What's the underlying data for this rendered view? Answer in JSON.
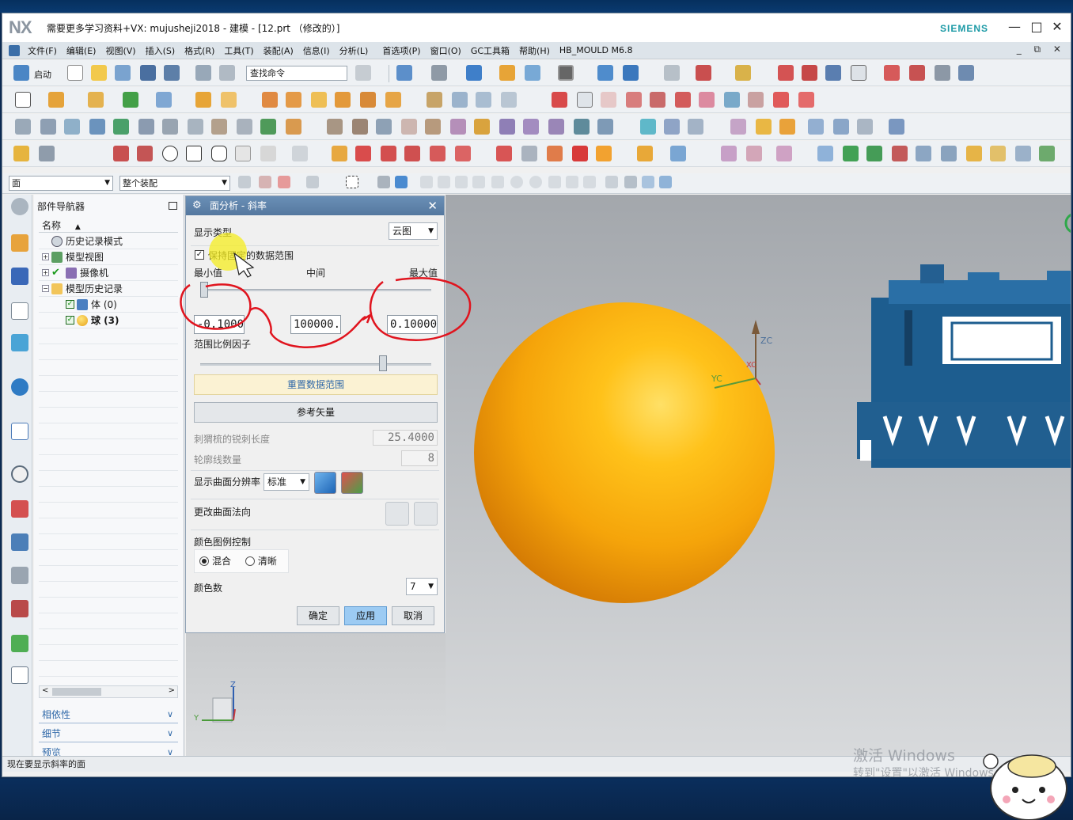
{
  "window": {
    "logo": "NX",
    "title": "需要更多学习资料+VX: mujusheji2018 - 建模 - [12.prt （修改的）]",
    "brand": "SIEMENS",
    "minimize": "—",
    "maximize": "□",
    "close": "✕"
  },
  "menu": {
    "items": [
      "文件(F)",
      "编辑(E)",
      "视图(V)",
      "插入(S)",
      "格式(R)",
      "工具(T)",
      "装配(A)",
      "信息(I)",
      "分析(L)",
      "首选项(P)",
      "窗口(O)",
      "GC工具箱",
      "帮助(H)",
      "HB_MOULD M6.8"
    ],
    "right_controls": "_ ⧉ ✕"
  },
  "toolbar": {
    "start_label": "启动",
    "search_placeholder": "查找命令",
    "filter_value": "面",
    "scope_value": "整个装配"
  },
  "navigator": {
    "title": "部件导航器",
    "column_name": "名称",
    "sort_arrow": "▲",
    "rows": [
      {
        "label": "历史记录模式"
      },
      {
        "label": "模型视图"
      },
      {
        "label": "摄像机"
      },
      {
        "label": "模型历史记录"
      },
      {
        "label": "体 (0)"
      },
      {
        "label": "球 (3)"
      }
    ],
    "sections": [
      {
        "label": "相依性"
      },
      {
        "label": "细节"
      },
      {
        "label": "预览"
      }
    ]
  },
  "dialog": {
    "title": "面分析 - 斜率",
    "display_type_label": "显示类型",
    "display_type_value": "云图",
    "keep_fixed_label": "保持固定的数据范围",
    "min_label": "最小值",
    "mid_label": "中间",
    "max_label": "最大值",
    "min_value": "-0.1000",
    "mid_value": "100000.",
    "max_value": "0.10000",
    "scale_label": "范围比例因子",
    "scale_fraction": 0.8,
    "reset_range_label": "重置数据范围",
    "ref_vector_label": "参考矢量",
    "comb_length_label": "刺猬梳的锐刺长度",
    "comb_length_value": "25.4000",
    "contour_count_label": "轮廓线数量",
    "contour_count_value": "8",
    "resolution_label": "显示曲面分辨率",
    "resolution_value": "标准",
    "change_normal_label": "更改曲面法向",
    "legend_control_label": "颜色图例控制",
    "blend_label": "混合",
    "sharp_label": "清晰",
    "color_count_label": "颜色数",
    "color_count_value": "7",
    "ok_label": "确定",
    "apply_label": "应用",
    "cancel_label": "取消"
  },
  "viewport": {
    "axis_zc": "ZC",
    "axis_yc": "YC",
    "axis_xc": "XC",
    "triad_z": "Z",
    "triad_y": "Y",
    "sphere_color": "#f5a40a",
    "part_color": "#1d5d8f"
  },
  "status": {
    "message": "现在要显示斜率的面"
  },
  "watermark": {
    "line1": "激活 Windows",
    "line2": "转到\"设置\"以激活 Windows。"
  },
  "colors": {
    "accent_blue": "#2f68a8",
    "annotation_red": "#e0141e",
    "highlight_yellow": "#f5ee20"
  }
}
